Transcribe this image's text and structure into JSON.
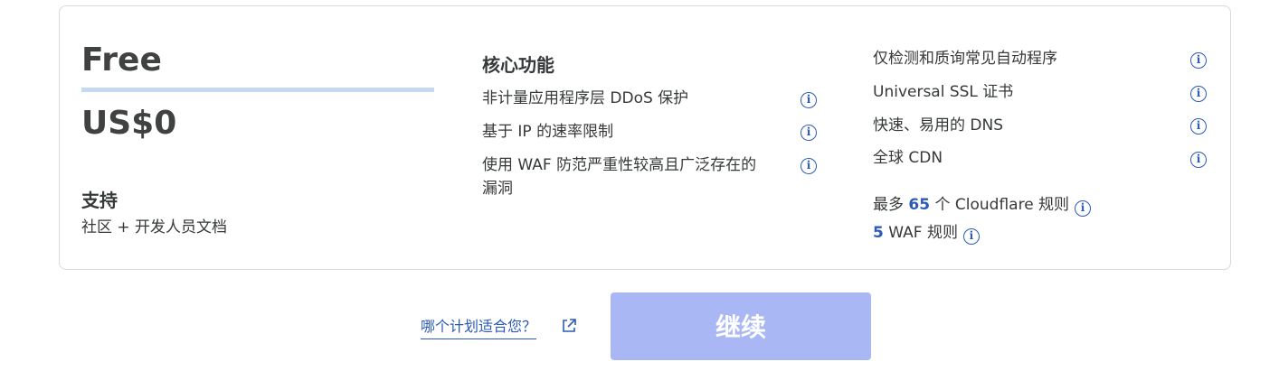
{
  "plan": {
    "name": "Free",
    "price": "US$0",
    "support_title": "支持",
    "support_text": "社区 + 开发人员文档"
  },
  "core": {
    "title": "核心功能",
    "features": [
      "非计量应用程序层 DDoS 保护",
      "基于 IP 的速率限制",
      "使用 WAF 防范严重性较高且广泛存在的",
      "漏洞"
    ]
  },
  "right": {
    "features": [
      "仅检测和质询常见自动程序",
      "Universal SSL 证书",
      "快速、易用的 DNS",
      "全球 CDN"
    ],
    "rules": {
      "line1_prefix": "最多",
      "line1_count": "65",
      "line1_suffix": "个 Cloudflare 规则",
      "line2_count": "5",
      "line2_suffix": "WAF 规则"
    }
  },
  "footer": {
    "help_link": "哪个计划适合您？",
    "continue_label": "继续"
  },
  "icons": {
    "info": "info-icon",
    "external": "external-link-icon"
  },
  "colors": {
    "accent": "#2c5ab8",
    "button_disabled": "#a9b8f4",
    "plan_bar": "#c5d9f1"
  }
}
